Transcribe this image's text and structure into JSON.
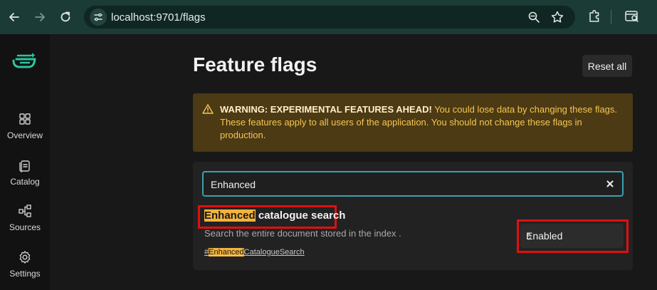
{
  "browser": {
    "url": "localhost:9701/flags",
    "icons": [
      "back-icon",
      "forward-icon",
      "reload-icon",
      "site-info-icon",
      "zoom-icon",
      "bookmark-star-icon",
      "extensions-icon",
      "side-panel-icon"
    ]
  },
  "sidebar": {
    "items": [
      {
        "label": "Overview",
        "icon": "grid-icon"
      },
      {
        "label": "Catalog",
        "icon": "catalog-icon"
      },
      {
        "label": "Sources",
        "icon": "sources-icon"
      },
      {
        "label": "Settings",
        "icon": "gear-icon"
      }
    ]
  },
  "page": {
    "title": "Feature flags",
    "reset_label": "Reset all"
  },
  "warning": {
    "heading": "WARNING: EXPERIMENTAL FEATURES AHEAD!",
    "body": " You could lose data by changing these flags. These features apply to all users of the application. You should not change these flags in production."
  },
  "search": {
    "value": "Enhanced"
  },
  "flag": {
    "title_highlight": "Enhanced",
    "title_rest": " catalogue search",
    "description": "Search the entire document stored in the index .",
    "link_prefix": "#",
    "link_highlight": "Enhanced",
    "link_rest": "CatalogueSearch",
    "state": "Enabled"
  },
  "colors": {
    "chrome_bg": "#1b3b36",
    "accent_green": "#2ec4a0",
    "warning_text": "#f6c650",
    "highlight": "#f3b33d",
    "annotation_red": "#e01010",
    "search_border": "#3aa0b0"
  }
}
